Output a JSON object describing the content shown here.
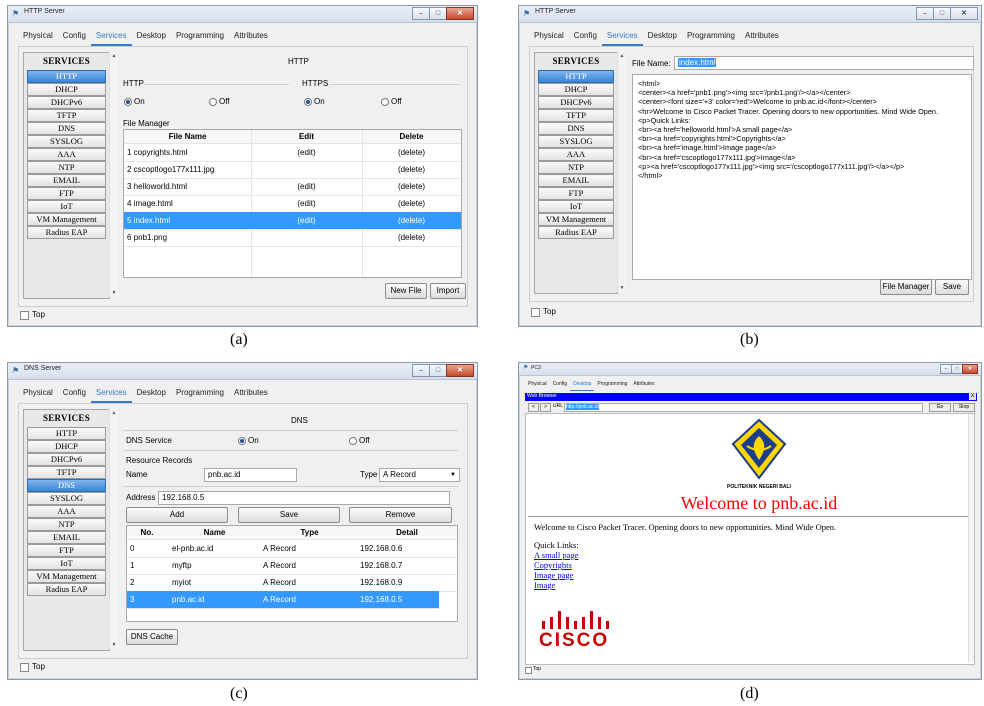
{
  "captions": {
    "a": "(a)",
    "b": "(b)",
    "c": "(c)",
    "d": "(d)"
  },
  "common": {
    "tabs": [
      "Physical",
      "Config",
      "Services",
      "Desktop",
      "Programming",
      "Attributes"
    ],
    "services_header": "SERVICES",
    "services": [
      "HTTP",
      "DHCP",
      "DHCPv6",
      "TFTP",
      "DNS",
      "SYSLOG",
      "AAA",
      "NTP",
      "EMAIL",
      "FTP",
      "IoT",
      "VM Management",
      "Radius EAP"
    ],
    "top_label": "Top",
    "window_buttons": [
      "–",
      "□",
      "✕"
    ],
    "accent": "#3a78c3",
    "selection_color": "#3399ff"
  },
  "a": {
    "title": "HTTP Server",
    "panel_title": "HTTP",
    "http_label": "HTTP",
    "https_label": "HTTPS",
    "on": "On",
    "off": "Off",
    "file_manager": "File Manager",
    "columns": [
      "File Name",
      "Edit",
      "Delete"
    ],
    "rows": [
      {
        "name": "1 copyrights.html",
        "edit": "(edit)",
        "delete": "(delete)"
      },
      {
        "name": "2 cscoptlogo177x111.jpg",
        "edit": "",
        "delete": "(delete)"
      },
      {
        "name": "3 helloworld.html",
        "edit": "(edit)",
        "delete": "(delete)"
      },
      {
        "name": "4 image.html",
        "edit": "(edit)",
        "delete": "(delete)"
      },
      {
        "name": "5 index.html",
        "edit": "(edit)",
        "delete": "(delete)"
      },
      {
        "name": "6 pnb1.png",
        "edit": "",
        "delete": "(delete)"
      }
    ],
    "new_file": "New File",
    "import": "Import"
  },
  "b": {
    "title": "HTTP Server",
    "file_name_label": "File Name:",
    "file_name_value": "index.html",
    "code": "<html>\n<center><a href='pnb1.png'><img src='/pnb1.png'/></a></center>\n<center><font size='+3' color='red'>Welcome to pnb.ac.id</font></center>\n<hr>Welcome to Cisco Packet Tracer. Opening doors to new opportunities. Mind Wide Open.\n<p>Quick Links:\n<br><a href='helloworld.html'>A small page</a>\n<br><a href='copyrights.html'>Copyrights</a>\n<br><a href='image.html'>Image page</a>\n<br><a href='cscoptlogo177x111.jpg'>Image</a>\n<p><a href='cscoptlogo177x111.jpg'><img src='/cscoptlogo177x111.jpg'/></a></p>\n</html>",
    "file_manager_btn": "File Manager",
    "save_btn": "Save"
  },
  "c": {
    "title": "DNS Server",
    "panel_title": "DNS",
    "dns_service": "DNS Service",
    "on": "On",
    "off": "Off",
    "resource_records": "Resource Records",
    "name_label": "Name",
    "name_value": "pnb.ac.id",
    "type_label": "Type",
    "type_value": "A Record",
    "address_label": "Address",
    "address_value": "192.168.0.5",
    "add": "Add",
    "save": "Save",
    "remove": "Remove",
    "columns": [
      "No.",
      "Name",
      "Type",
      "Detail"
    ],
    "rows": [
      {
        "no": "0",
        "name": "el-pnb.ac.id",
        "type": "A Record",
        "detail": "192.168.0.6"
      },
      {
        "no": "1",
        "name": "myftp",
        "type": "A Record",
        "detail": "192.168.0.7"
      },
      {
        "no": "2",
        "name": "myiot",
        "type": "A Record",
        "detail": "192.168.0.9"
      },
      {
        "no": "3",
        "name": "pnb.ac.id",
        "type": "A Record",
        "detail": "192.168.0.5"
      }
    ],
    "dns_cache": "DNS Cache"
  },
  "d": {
    "title": "PC3",
    "tabs": [
      "Physical",
      "Config",
      "Desktop",
      "Programming",
      "Attributes"
    ],
    "browser_title": "Web Browser",
    "close": "X",
    "url_label": "URL",
    "url_value": "http://pnb.ac.id",
    "go": "Go",
    "stop": "Stop",
    "logo_caption": "POLITEKNIK NEGERI BALI",
    "welcome": "Welcome to pnb.ac.id",
    "intro": "Welcome to Cisco Packet Tracer. Opening doors to new opportunities. Mind Wide Open.",
    "quick_links": "Quick Links:",
    "links": [
      "A small page",
      "Copyrights",
      "Image page",
      "Image"
    ],
    "cisco_text": "CISCO",
    "top_label": "Top",
    "browser_bar_color": "#0000ff",
    "welcome_color": "#ff0000",
    "cisco_color": "#cc0000"
  }
}
